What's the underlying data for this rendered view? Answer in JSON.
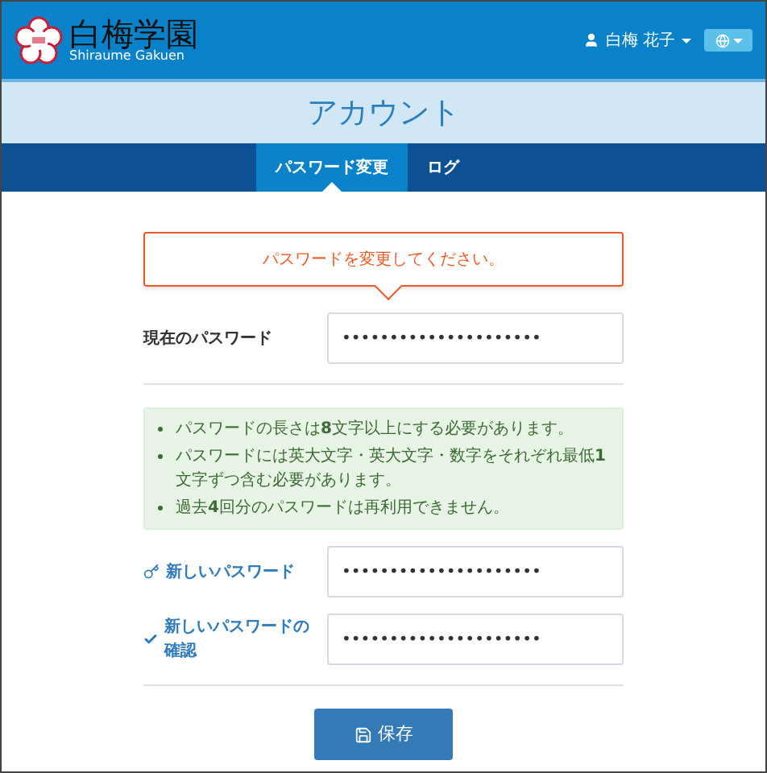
{
  "header": {
    "logo_kanji": "白梅学園",
    "logo_romaji": "Shiraume Gakuen",
    "user_name": "白梅 花子"
  },
  "page_title": "アカウント",
  "tabs": [
    {
      "label": "パスワード変更",
      "selected": true
    },
    {
      "label": "ログ",
      "selected": false
    }
  ],
  "alert": "パスワードを変更してください。",
  "current_password": {
    "label": "現在のパスワード",
    "value": "•••••••••••••••••••••"
  },
  "rules": [
    "パスワードの長さは**8**文字以上にする必要があります。",
    "パスワードには英大文字・英大文字・数字をそれぞれ最低**1**文字ずつ含む必要があります。",
    "過去**4**回分のパスワードは再利用できません。"
  ],
  "new_fields": [
    {
      "kind": "key",
      "label": "新しいパスワード",
      "value": "•••••••••••••••••••••"
    },
    {
      "kind": "check",
      "label": "新しいパスワードの確認",
      "value": "•••••••••••••••••••••"
    }
  ],
  "save_button": "保存"
}
